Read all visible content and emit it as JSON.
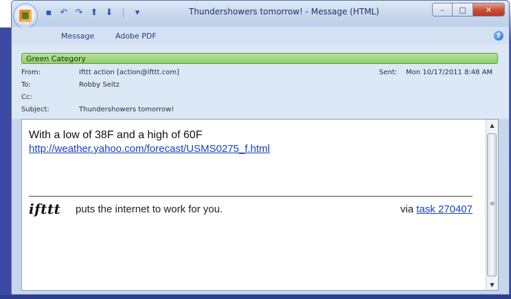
{
  "window": {
    "title": "Thundershowers tomorrow! - Message (HTML)",
    "controls": {
      "minimize": "–",
      "maximize": "□",
      "close": "✕"
    }
  },
  "quick_access": [
    {
      "icon": "save-icon",
      "glyph": "▪"
    },
    {
      "icon": "undo-icon",
      "glyph": "↶"
    },
    {
      "icon": "redo-icon",
      "glyph": "↷"
    },
    {
      "icon": "previous-item-icon",
      "glyph": "⬆"
    },
    {
      "icon": "next-item-icon",
      "glyph": "⬇"
    },
    {
      "icon": "customize-icon",
      "glyph": "▾"
    }
  ],
  "ribbon": {
    "tabs": [
      "Message",
      "Adobe PDF"
    ],
    "help": "?"
  },
  "message_header": {
    "category": "Green Category",
    "from_label": "From:",
    "from_value": "ifttt action [action@ifttt.com]",
    "to_label": "To:",
    "to_value": "Robby Seitz",
    "cc_label": "Cc:",
    "cc_value": "",
    "subject_label": "Subject:",
    "subject_value": "Thundershowers tomorrow!",
    "sent_label": "Sent:",
    "sent_value": "Mon 10/17/2011 8:48 AM"
  },
  "message_body": {
    "line1": "With a low of 38F and a high of 60F",
    "link": "http://weather.yahoo.com/forecast/USMS0275_f.html",
    "logo": "ifttt",
    "tagline": "puts the internet to work for you.",
    "via_text": "via ",
    "task_link": "task 270407"
  },
  "colors": {
    "category_green": "#8fce6e",
    "link_blue": "#1440c8",
    "desktop_blue": "#3b4fa8"
  }
}
